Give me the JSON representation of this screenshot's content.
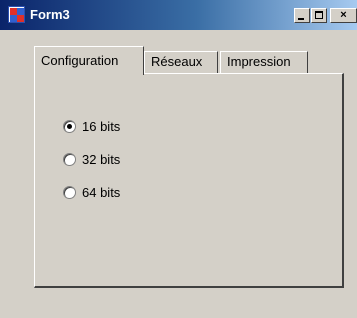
{
  "window": {
    "title": "Form3",
    "minimize_label": "_",
    "maximize_label": "",
    "close_label": "×"
  },
  "tabs": [
    {
      "label": "Configuration",
      "active": true
    },
    {
      "label": "Réseaux",
      "active": false
    },
    {
      "label": "Impression",
      "active": false
    }
  ],
  "options": [
    {
      "label": "16 bits",
      "selected": true
    },
    {
      "label": "32 bits",
      "selected": false
    },
    {
      "label": "64 bits",
      "selected": false
    }
  ],
  "colors": {
    "titlebar_start": "#0a246a",
    "titlebar_end": "#a6caf0",
    "face": "#d4d0c8"
  }
}
